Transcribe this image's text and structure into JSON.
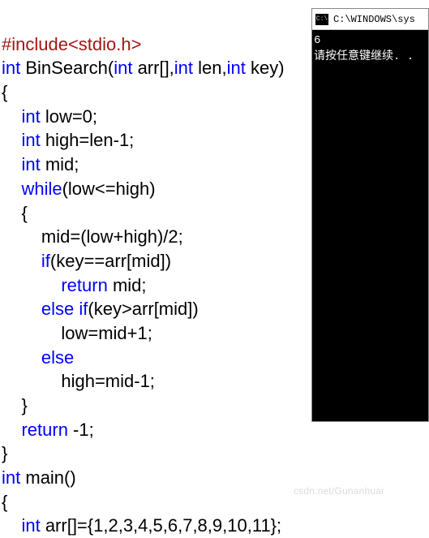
{
  "code": {
    "include_directive": "#include",
    "include_header": "<stdio.h>",
    "int_kw": "int",
    "fn_name": " BinSearch(",
    "arr_param": " arr[],",
    "len_param": " len,",
    "key_param": " key)",
    "obrace": "{",
    "low_decl": " low=0;",
    "high_decl": " high=len-1;",
    "mid_decl": " mid;",
    "while_kw": "while",
    "while_cond": "(low<=high)",
    "mid_assign": "        mid=(low+high)/2;",
    "if_kw": "if",
    "if_cond": "(key==arr[mid])",
    "return_kw": "return",
    "return_mid": " mid;",
    "else_kw": "else",
    "elseif_cond": "(key>arr[mid])",
    "low_assign": "            low=mid+1;",
    "high_assign": "            high=mid-1;",
    "cbrace_inner": "    }",
    "return_neg1": " -1;",
    "cbrace": "}",
    "main_name": " main()",
    "arr_init": " arr[]={1,2,3,4,5,6,7,8,9,10,11};"
  },
  "console": {
    "icon_text": "C:\\",
    "title": "C:\\WINDOWS\\sys",
    "out_value": "6",
    "prompt": "请按任意键继续. ."
  },
  "watermark": "csdn.net/Gunanhuai"
}
